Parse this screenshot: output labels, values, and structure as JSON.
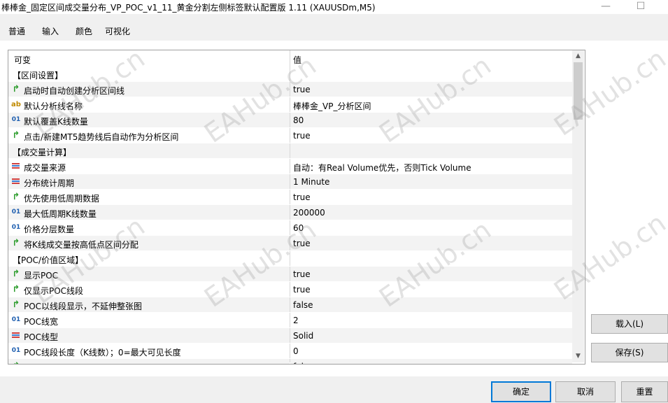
{
  "window": {
    "title": "棒棒金_固定区间成交量分布_VP_POC_v1_11_黄金分割左侧标签默认配置版 1.11 (XAUUSDm,M5)"
  },
  "tabs": [
    {
      "label": "普通",
      "active": false
    },
    {
      "label": "输入",
      "active": true
    },
    {
      "label": "颜色",
      "active": false
    },
    {
      "label": "可视化",
      "active": false
    }
  ],
  "grid": {
    "headers": {
      "variable": "可变",
      "value": "值"
    },
    "rows": [
      {
        "type": "section",
        "label": "【区间设置】",
        "value": ""
      },
      {
        "type": "bool",
        "icon": "bool-arrow-icon",
        "label": "启动时自动创建分析区间线",
        "value": "true"
      },
      {
        "type": "string",
        "icon": "string-ab-icon",
        "label": "默认分析线名称",
        "value": "棒棒金_VP_分析区间"
      },
      {
        "type": "number",
        "icon": "integer-01-icon",
        "label": "默认覆盖K线数量",
        "value": "80"
      },
      {
        "type": "bool",
        "icon": "bool-arrow-icon",
        "label": "点击/新建MT5趋势线后自动作为分析区间",
        "value": "true"
      },
      {
        "type": "section",
        "label": "【成交量计算】",
        "value": ""
      },
      {
        "type": "enum",
        "icon": "enum-list-icon",
        "label": "成交量来源",
        "value": "自动：有Real Volume优先，否则Tick Volume"
      },
      {
        "type": "enum",
        "icon": "enum-list-icon",
        "label": "分布统计周期",
        "value": "1 Minute"
      },
      {
        "type": "bool",
        "icon": "bool-arrow-icon",
        "label": "优先使用低周期数据",
        "value": "true"
      },
      {
        "type": "number",
        "icon": "integer-01-icon",
        "label": "最大低周期K线数量",
        "value": "200000"
      },
      {
        "type": "number",
        "icon": "integer-01-icon",
        "label": "价格分层数量",
        "value": "60"
      },
      {
        "type": "bool",
        "icon": "bool-arrow-icon",
        "label": "将K线成交量按高低点区间分配",
        "value": "true"
      },
      {
        "type": "section",
        "label": "【POC/价值区域】",
        "value": ""
      },
      {
        "type": "bool",
        "icon": "bool-arrow-icon",
        "label": "显示POC",
        "value": "true"
      },
      {
        "type": "bool",
        "icon": "bool-arrow-icon",
        "label": "仅显示POC线段",
        "value": "true"
      },
      {
        "type": "bool",
        "icon": "bool-arrow-icon",
        "label": "POC以线段显示，不延伸整张图",
        "value": "false"
      },
      {
        "type": "number",
        "icon": "integer-01-icon",
        "label": "POC线宽",
        "value": "2"
      },
      {
        "type": "enum",
        "icon": "enum-list-icon",
        "label": "POC线型",
        "value": "Solid"
      },
      {
        "type": "number",
        "icon": "integer-01-icon",
        "label": "POC线段长度（K线数）；0=最大可见长度",
        "value": "0"
      },
      {
        "type": "bool",
        "icon": "bool-arrow-icon",
        "label": "显示VAH/VAL",
        "value": "false"
      }
    ]
  },
  "side_buttons": {
    "load": "载入(L)",
    "save": "保存(S)"
  },
  "bottom_buttons": {
    "ok": "确定",
    "cancel": "取消",
    "reset": "重置"
  },
  "watermark_text": "EAHub.cn",
  "colors": {
    "accent": "#0078d7",
    "bool_icon": "#2e9d2e",
    "number_icon": "#1f5fb0",
    "string_icon": "#c08a00"
  }
}
